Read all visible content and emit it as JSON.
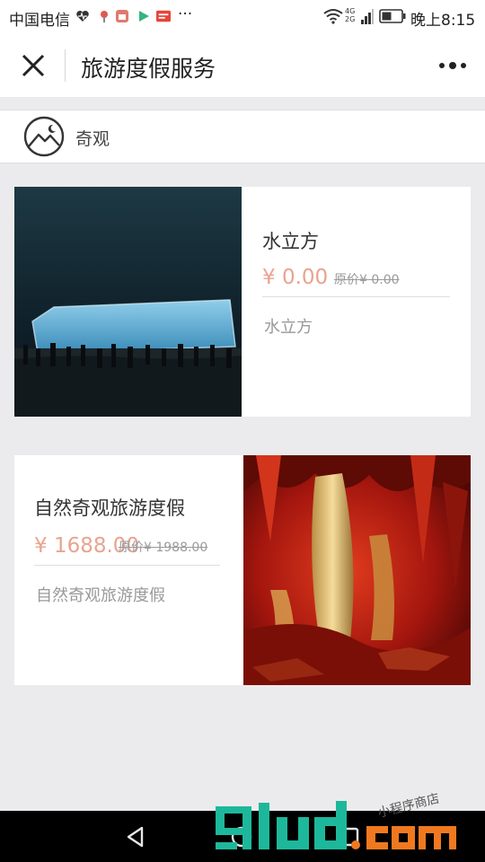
{
  "status_bar": {
    "carrier": "中国电信",
    "time": "晚上8:15",
    "network": "4G 2G",
    "overflow": "···"
  },
  "nav": {
    "title": "旅游度假服务",
    "close_icon": "close-icon",
    "more_icon": "more-icon"
  },
  "shop": {
    "name": "奇观",
    "logo_icon": "mountain-moon-icon"
  },
  "products": [
    {
      "title": "水立方",
      "price": "¥ 0.00",
      "original_price": "原价¥ 0.00",
      "description": "水立方",
      "image": "water-cube-night-photo"
    },
    {
      "title": "自然奇观旅游度假",
      "price": "¥ 1688.00",
      "original_price": "原价¥ 1988.00",
      "description": "自然奇观旅游度假",
      "image": "karst-cave-photo"
    }
  ],
  "watermark": {
    "brand": "91ud.com",
    "tagline": "小程序商店"
  },
  "colors": {
    "price": "#e8a48f",
    "page_bg": "#ebebed",
    "watermark_green": "#1db89c",
    "watermark_orange": "#f0791f"
  }
}
